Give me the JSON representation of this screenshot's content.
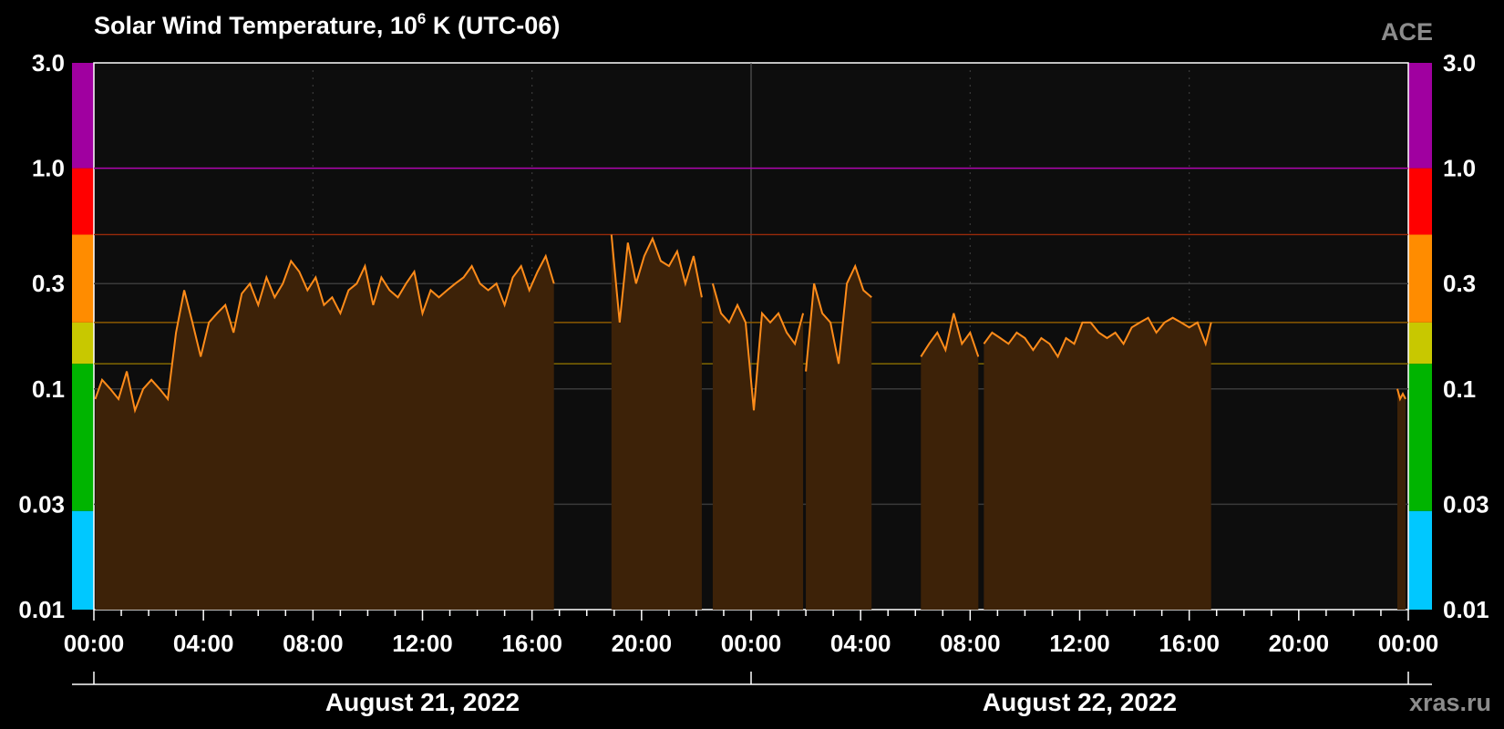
{
  "header": {
    "title_main": "Solar Wind Temperature, 10",
    "title_sup": "6",
    "title_rest": " K (UTC-06)",
    "satellite": "ACE",
    "source": "xras.ru"
  },
  "chart_data": {
    "type": "bar",
    "title": "Solar Wind Temperature, 10^6 K (UTC-06)",
    "ylabel": "",
    "xlabel": "",
    "y_scale": "log",
    "ylim": [
      0.01,
      3.0
    ],
    "y_ticks": [
      {
        "value": 0.01,
        "label": "0.01"
      },
      {
        "value": 0.03,
        "label": "0.03"
      },
      {
        "value": 0.1,
        "label": "0.1"
      },
      {
        "value": 0.3,
        "label": "0.3"
      },
      {
        "value": 1.0,
        "label": "1.0"
      },
      {
        "value": 3.0,
        "label": "3.0"
      }
    ],
    "x_unit": "hours since 2022-08-21 00:00 (UTC-06)",
    "xlim": [
      0,
      48
    ],
    "x_ticks": [
      {
        "value": 0,
        "label": "00:00"
      },
      {
        "value": 4,
        "label": "04:00"
      },
      {
        "value": 8,
        "label": "08:00"
      },
      {
        "value": 12,
        "label": "12:00"
      },
      {
        "value": 16,
        "label": "16:00"
      },
      {
        "value": 20,
        "label": "20:00"
      },
      {
        "value": 24,
        "label": "00:00"
      },
      {
        "value": 28,
        "label": "04:00"
      },
      {
        "value": 32,
        "label": "08:00"
      },
      {
        "value": 36,
        "label": "12:00"
      },
      {
        "value": 40,
        "label": "16:00"
      },
      {
        "value": 44,
        "label": "20:00"
      },
      {
        "value": 48,
        "label": "00:00"
      }
    ],
    "dates": [
      {
        "label": "August 21, 2022",
        "center_hour": 12
      },
      {
        "label": "August 22, 2022",
        "center_hour": 36
      }
    ],
    "threshold_bands": [
      {
        "from": 0.01,
        "to": 0.028,
        "color": "#00c8ff"
      },
      {
        "from": 0.028,
        "to": 0.13,
        "color": "#00b400"
      },
      {
        "from": 0.13,
        "to": 0.2,
        "color": "#c8c800"
      },
      {
        "from": 0.2,
        "to": 0.5,
        "color": "#ff8c00"
      },
      {
        "from": 0.5,
        "to": 1.0,
        "color": "#ff0000"
      },
      {
        "from": 1.0,
        "to": 3.0,
        "color": "#a000a0"
      }
    ],
    "threshold_lines": [
      {
        "value": 0.13,
        "color": "#8c7000"
      },
      {
        "value": 0.2,
        "color": "#8c5a00"
      },
      {
        "value": 0.5,
        "color": "#9a2a0a"
      },
      {
        "value": 1.0,
        "color": "#b400b4"
      }
    ],
    "series": [
      {
        "color": "#ff8c1a",
        "fill": "#3d2208",
        "segments": [
          {
            "x": [
              0.05,
              0.3,
              0.6,
              0.9,
              1.2,
              1.5,
              1.8,
              2.1,
              2.4,
              2.7,
              3.0,
              3.3,
              3.6,
              3.9,
              4.2,
              4.5,
              4.8,
              5.1,
              5.4,
              5.7,
              6.0,
              6.3,
              6.6,
              6.9,
              7.2,
              7.5,
              7.8,
              8.1,
              8.4,
              8.7,
              9.0,
              9.3,
              9.6,
              9.9,
              10.2,
              10.5,
              10.8,
              11.1,
              11.4,
              11.7,
              12.0,
              12.3,
              12.6,
              12.9,
              13.2,
              13.5,
              13.8,
              14.1,
              14.4,
              14.7,
              15.0,
              15.3,
              15.6,
              15.9,
              16.2,
              16.5,
              16.8
            ],
            "y": [
              0.09,
              0.11,
              0.1,
              0.09,
              0.12,
              0.08,
              0.1,
              0.11,
              0.1,
              0.09,
              0.18,
              0.28,
              0.2,
              0.14,
              0.2,
              0.22,
              0.24,
              0.18,
              0.27,
              0.3,
              0.24,
              0.32,
              0.26,
              0.3,
              0.38,
              0.34,
              0.28,
              0.32,
              0.24,
              0.26,
              0.22,
              0.28,
              0.3,
              0.36,
              0.24,
              0.32,
              0.28,
              0.26,
              0.3,
              0.34,
              0.22,
              0.28,
              0.26,
              0.28,
              0.3,
              0.32,
              0.36,
              0.3,
              0.28,
              0.3,
              0.24,
              0.32,
              0.36,
              0.28,
              0.34,
              0.4,
              0.3
            ]
          },
          {
            "x": [
              18.9,
              19.2,
              19.5,
              19.8,
              20.1,
              20.4,
              20.7,
              21.0,
              21.3,
              21.6,
              21.9,
              22.2
            ],
            "y": [
              0.5,
              0.2,
              0.46,
              0.3,
              0.4,
              0.48,
              0.38,
              0.36,
              0.42,
              0.3,
              0.4,
              0.26
            ]
          },
          {
            "x": [
              22.6,
              22.9,
              23.2,
              23.5,
              23.8,
              24.1,
              24.4,
              24.7,
              25.0,
              25.3,
              25.6,
              25.9
            ],
            "y": [
              0.3,
              0.22,
              0.2,
              0.24,
              0.2,
              0.08,
              0.22,
              0.2,
              0.22,
              0.18,
              0.16,
              0.22
            ]
          },
          {
            "x": [
              26.0,
              26.3,
              26.6,
              26.9,
              27.2,
              27.5,
              27.8,
              28.1,
              28.4
            ],
            "y": [
              0.12,
              0.3,
              0.22,
              0.2,
              0.13,
              0.3,
              0.36,
              0.28,
              0.26
            ]
          },
          {
            "x": [
              30.2,
              30.5,
              30.8,
              31.1,
              31.4,
              31.7,
              32.0,
              32.3
            ],
            "y": [
              0.14,
              0.16,
              0.18,
              0.15,
              0.22,
              0.16,
              0.18,
              0.14
            ]
          },
          {
            "x": [
              32.5,
              32.8,
              33.1,
              33.4,
              33.7,
              34.0,
              34.3,
              34.6,
              34.9,
              35.2,
              35.5,
              35.8,
              36.1,
              36.4,
              36.7,
              37.0,
              37.3,
              37.6,
              37.9,
              38.2,
              38.5,
              38.8,
              39.1,
              39.4,
              39.7,
              40.0,
              40.3,
              40.6,
              40.8
            ],
            "y": [
              0.16,
              0.18,
              0.17,
              0.16,
              0.18,
              0.17,
              0.15,
              0.17,
              0.16,
              0.14,
              0.17,
              0.16,
              0.2,
              0.2,
              0.18,
              0.17,
              0.18,
              0.16,
              0.19,
              0.2,
              0.21,
              0.18,
              0.2,
              0.21,
              0.2,
              0.19,
              0.2,
              0.16,
              0.2
            ]
          },
          {
            "x": [
              47.6,
              47.7,
              47.8,
              47.9
            ],
            "y": [
              0.1,
              0.09,
              0.095,
              0.09
            ]
          }
        ]
      }
    ]
  }
}
